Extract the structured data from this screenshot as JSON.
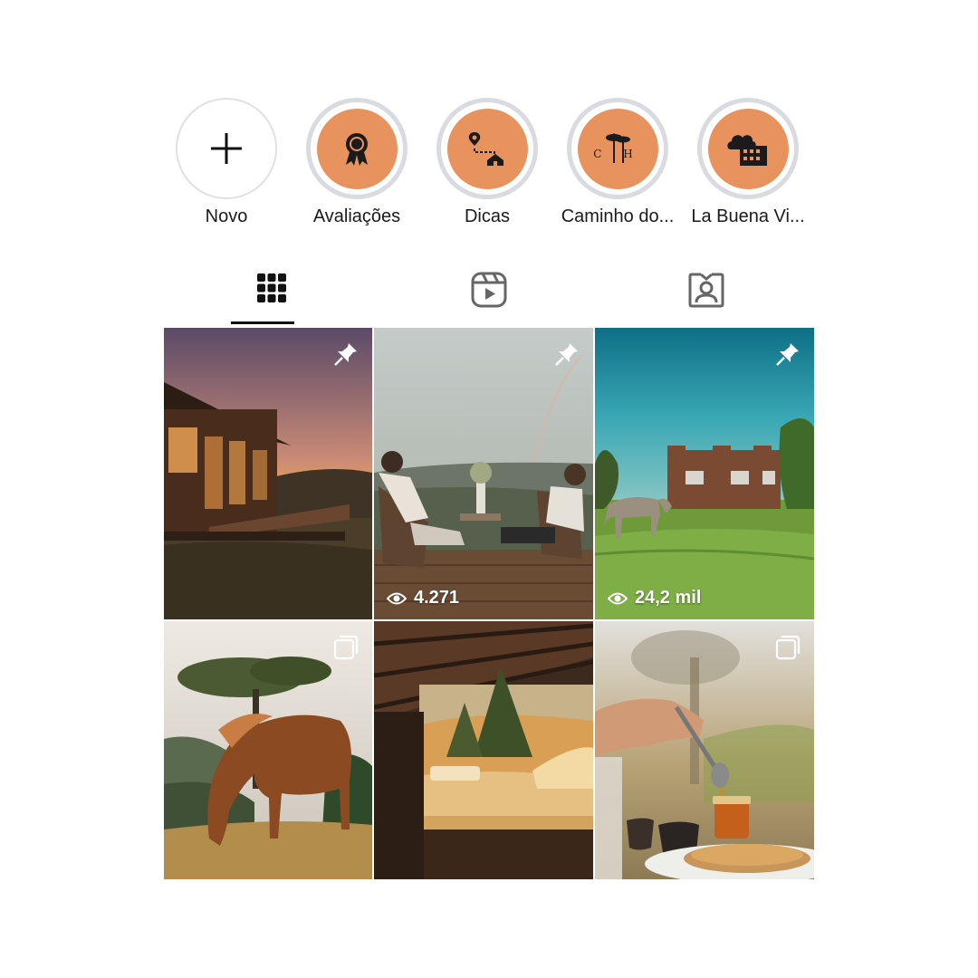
{
  "highlights": [
    {
      "label": "Novo",
      "icon": "plus-icon"
    },
    {
      "label": "Avaliações",
      "icon": "award-badge-icon"
    },
    {
      "label": "Dicas",
      "icon": "route-pin-house-icon"
    },
    {
      "label": "Caminho do...",
      "icon": "pine-trees-cth-icon",
      "cover_text": "C H"
    },
    {
      "label": "La Buena Vi...",
      "icon": "cloud-building-icon"
    }
  ],
  "tabs": [
    {
      "name": "posts",
      "icon": "grid-icon",
      "active": true
    },
    {
      "name": "reels",
      "icon": "reels-icon",
      "active": false
    },
    {
      "name": "tagged",
      "icon": "tagged-person-icon",
      "active": false
    }
  ],
  "posts": [
    {
      "scene": "wooden cabin at sunset",
      "badge": "pin-icon",
      "views": ""
    },
    {
      "scene": "couple on deck with mountain view and rainbow",
      "badge": "pin-icon",
      "views": "4.271"
    },
    {
      "scene": "brick building with horses on lawn",
      "badge": "pin-icon",
      "views": "24,2 mil"
    },
    {
      "scene": "horse grazing under tree",
      "badge": "carousel-icon",
      "views": ""
    },
    {
      "scene": "bed in open-air cabin",
      "badge": "",
      "views": ""
    },
    {
      "scene": "honey dripping on pancakes",
      "badge": "carousel-icon",
      "views": ""
    }
  ],
  "colors": {
    "highlight_fill": "#e8935d",
    "ring": "#d9dbe1",
    "text": "#111111"
  }
}
